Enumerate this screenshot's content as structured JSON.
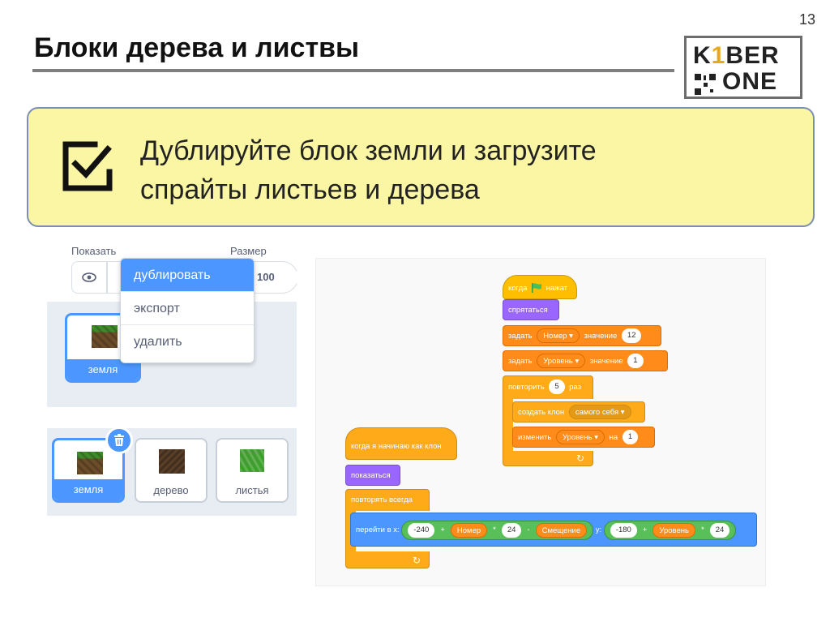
{
  "page_number": "13",
  "title": "Блоки дерева и листвы",
  "logo": {
    "line1_k": "K",
    "line1_one": "1",
    "line1_ber": "BER",
    "line2": "ONE"
  },
  "note": {
    "line1": "Дублируйте блок земли и загрузите",
    "line2": "спрайты листьев и дерева"
  },
  "sprite_panel": {
    "show_label": "Показать",
    "size_label": "Размер",
    "size_value": "100",
    "selected_sprite": "земля",
    "context_menu": [
      "дублировать",
      "экспорт",
      "удалить"
    ]
  },
  "sprites": [
    {
      "name": "земля"
    },
    {
      "name": "дерево"
    },
    {
      "name": "листья"
    }
  ],
  "code": {
    "script1": {
      "when_flag_clicked_1": "когда",
      "when_flag_clicked_2": "нажат",
      "hide": "спрятаться",
      "set1_label": "задать",
      "set1_var": "Номер",
      "set1_mid": "значение",
      "set1_value": "12",
      "set2_label": "задать",
      "set2_var": "Уровень",
      "set2_mid": "значение",
      "set2_value": "1",
      "repeat_label": "повторить",
      "repeat_value": "5",
      "repeat_suffix": "раз",
      "clone_label": "создать клон",
      "clone_target": "самого себя",
      "change_label": "изменить",
      "change_var": "Уровень",
      "change_mid": "на",
      "change_value": "1"
    },
    "script2": {
      "when_clone": "когда я начинаю как клон",
      "show": "показаться",
      "forever": "повторять всегда",
      "goto_label": "перейти в x:",
      "x_const": "-240",
      "plus1": "+",
      "x_var": "Номер",
      "times1": "*",
      "x_mult": "24",
      "minus": "-",
      "x_offset": "Смещение",
      "y_label": "y:",
      "y_const": "-180",
      "plus2": "+",
      "y_var": "Уровень",
      "times2": "*",
      "y_mult": "24"
    }
  },
  "colors": {
    "note_bg": "#fbf6a3",
    "scratch_blue": "#4c97ff",
    "events": "#ffbf00",
    "looks": "#9966ff",
    "control": "#ffab19",
    "variables": "#ff8c1a",
    "operators": "#59c059"
  }
}
